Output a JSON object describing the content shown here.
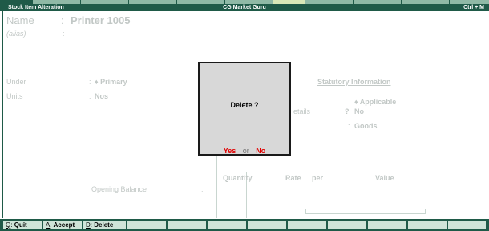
{
  "window": {
    "left_title": "Stock Item Alteration",
    "center_title": "CG Market Guru",
    "shortcut": "Ctrl + M"
  },
  "item": {
    "name_label": "Name",
    "name_value": "Printer 1005",
    "alias_label": "(alias)",
    "colon": ":"
  },
  "fields": {
    "under_label": "Under",
    "under_value": "♦ Primary",
    "units_label": "Units",
    "units_value": "Nos"
  },
  "statutory": {
    "heading": "Statutory Information",
    "details_partial": "etails",
    "applicable_value": "♦ Applicable",
    "qmark": "?",
    "no_value": "No",
    "goods_value": "Goods",
    "colon": ":"
  },
  "table": {
    "quantity": "Quantity",
    "rate": "Rate",
    "per": "per",
    "value": "Value",
    "opening_balance_label": "Opening Balance",
    "colon": ":"
  },
  "dialog": {
    "message": "Delete ?",
    "yes": "Yes",
    "or": "or",
    "no": "No"
  },
  "bottom": {
    "quit_key": "Q",
    "quit_label": "Quit",
    "accept_key": "A",
    "accept_label": "Accept",
    "delete_key": "D",
    "delete_label": "Delete"
  },
  "colors": {
    "accent": "#1f5a48",
    "danger": "#e00000",
    "dialog_bg": "#d8d8d8"
  }
}
